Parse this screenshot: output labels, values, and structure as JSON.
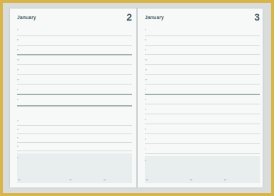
{
  "left_page": {
    "title": "January",
    "day_number": "2",
    "rows": [
      "7",
      "8",
      "9",
      "10",
      "11",
      "12",
      "1",
      "2",
      "3",
      "4",
      "5",
      "6",
      "7",
      "8",
      "9",
      "10"
    ],
    "footer_labels": [
      "Ei",
      "Ei",
      "Ei"
    ]
  },
  "right_page": {
    "title": "January",
    "day_number": "3",
    "rows": [
      "7",
      "8",
      "9",
      "10",
      "11",
      "12",
      "1",
      "2",
      "3",
      "4",
      "5",
      "6",
      "7",
      "8",
      "9",
      "10"
    ],
    "footer_labels": [
      "Ei",
      "Ei",
      "Ei"
    ]
  }
}
